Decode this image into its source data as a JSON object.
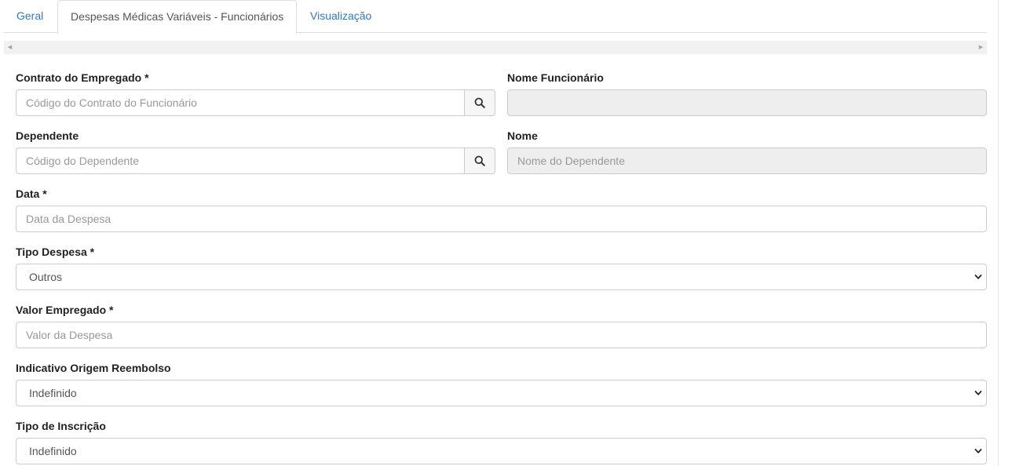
{
  "tabs": [
    {
      "label": "Geral"
    },
    {
      "label": "Despesas Médicas Variáveis - Funcionários"
    },
    {
      "label": "Visualização"
    }
  ],
  "active_tab": "Despesas Médicas Variáveis - Funcionários",
  "scroller": {
    "left_icon": "caret-left-icon",
    "right_icon": "caret-right-icon"
  },
  "form": {
    "contrato": {
      "label": "Contrato do Empregado *",
      "placeholder": "Código do Contrato do Funcionário",
      "value": "",
      "icon": "search-icon"
    },
    "nome_funcionario": {
      "label": "Nome Funcionário",
      "placeholder": "",
      "value": ""
    },
    "dependente": {
      "label": "Dependente",
      "placeholder": "Código do Dependente",
      "value": "",
      "icon": "search-icon"
    },
    "nome": {
      "label": "Nome",
      "placeholder": "Nome do Dependente",
      "value": ""
    },
    "data": {
      "label": "Data *",
      "placeholder": "Data da Despesa",
      "value": ""
    },
    "tipo_despesa": {
      "label": "Tipo Despesa *",
      "selected": "Outros"
    },
    "valor_empregado": {
      "label": "Valor Empregado *",
      "placeholder": "Valor da Despesa",
      "value": ""
    },
    "indicativo_origem": {
      "label": "Indicativo Origem Reembolso",
      "selected": "Indefinido"
    },
    "tipo_inscricao": {
      "label": "Tipo de Inscrição",
      "selected": "Indefinido"
    }
  },
  "colors": {
    "link": "#337ab7",
    "readonly_bg": "#eeeeee",
    "border": "#cccccc"
  }
}
